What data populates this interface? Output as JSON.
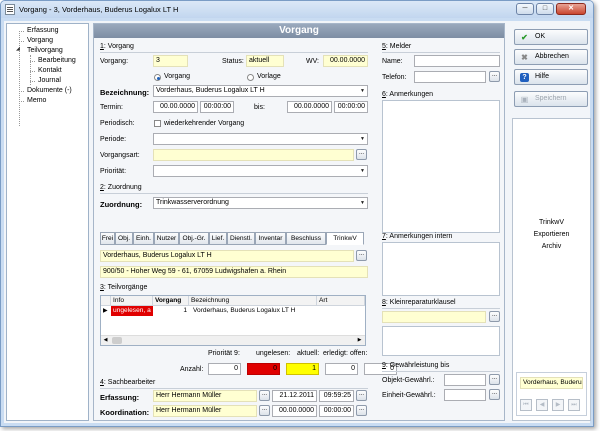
{
  "window": {
    "title": "Vorgang - 3, Vorderhaus, Buderus Logalux LT H",
    "min": "─",
    "max": "□",
    "close": "✕"
  },
  "tree": {
    "erfassung": "Erfassung",
    "vorgang": "Vorgang",
    "teilvorgang": "Teilvorgang",
    "bearbeitung": "Bearbeitung",
    "kontakt": "Kontakt",
    "journal": "Journal",
    "dokumente": "Dokumente (-)",
    "memo": "Memo"
  },
  "header": "Vorgang",
  "s1": {
    "title_num": "1",
    "title_text": ": Vorgang",
    "vorgang_label": "Vorgang:",
    "vorgang_value": "3",
    "status_label": "Status:",
    "status_value": "aktuell",
    "wv_label": "WV:",
    "wv_value": "00.00.0000",
    "radio_vorgang": "Vorgang",
    "radio_vorlage": "Vorlage",
    "bez_label": "Bezeichnung:",
    "bez_value": "Vorderhaus, Buderus Logalux LT H",
    "termin_label": "Termin:",
    "termin_date": "00.00.0000",
    "termin_time": "00:00:00",
    "bis_label": "bis:",
    "bis_date": "00.00.0000",
    "bis_time": "00:00:00",
    "periodisch_label": "Periodisch:",
    "periodisch_check": "wiederkehrender Vorgang",
    "periode_label": "Periode:",
    "vorgangsart_label": "Vorgangsart:",
    "prioritaet_label": "Priorität:",
    "dots": "..."
  },
  "s2": {
    "title_num": "2",
    "title_text": ": Zuordnung",
    "zuordnung_label": "Zuordnung:",
    "zuordnung_value": "Trinkwasserverordnung",
    "tabs": [
      "Frei",
      "Obj.",
      "Einh.",
      "Nutzer",
      "Obj.-Gr.",
      "Lief.",
      "Dienstl.",
      "Inventar",
      "Beschluss",
      "TrinkwV"
    ],
    "line1": "Vorderhaus, Buderus Logalux LT H",
    "line2": "900/50 - Hoher Weg 59 - 61, 67059 Ludwigshafen a. Rhein"
  },
  "s3": {
    "title_num": "3",
    "title_text": ": Teilvorgänge",
    "cols": [
      "Info",
      "Vorgang",
      "Bezeichnung",
      "Art"
    ],
    "row": {
      "marker": "▶",
      "info": "ungelesen, a",
      "vorgang": "1",
      "bez": "Vorderhaus, Buderus Logalux LT H",
      "art": ""
    },
    "prio_label": "Priorität 9:",
    "ungelesen_label": "ungelesen:",
    "aktuell_label": "aktuell:",
    "erledigt_label": "erledigt:",
    "offen_label": "offen:",
    "anzahl_label": "Anzahl:",
    "prio_val": "0",
    "ungelesen_val": "0",
    "aktuell_val": "1",
    "erledigt_val": "0",
    "offen_val": "0"
  },
  "s4": {
    "title_num": "4",
    "title_text": ": Sachbearbeiter",
    "erfassung_label": "Erfassung:",
    "erfassung_name": "Herr Hermann Müller",
    "erfassung_date": "21.12.2011",
    "erfassung_time": "09:59:25",
    "koord_label": "Koordination:",
    "koord_name": "Herr Hermann Müller",
    "koord_date": "00.00.0000",
    "koord_time": "00:00:00"
  },
  "s5": {
    "title_num": "5",
    "title_text": ": Melder",
    "name_label": "Name:",
    "telefon_label": "Telefon:"
  },
  "s6": {
    "title_num": "6",
    "title_text": ": Anmerkungen"
  },
  "s7": {
    "title_num": "7",
    "title_text": ": Anmerkungen intern"
  },
  "s8": {
    "title_num": "8",
    "title_text": ": Kleinreparaturklausel"
  },
  "s9": {
    "title_num": "9",
    "title_text": ": Gewährleistung bis",
    "objekt_label": "Objekt-Gewährl.:",
    "einheit_label": "Einheit-Gewährl.:"
  },
  "buttons": {
    "ok": "OK",
    "abbrechen": "Abbrechen",
    "hilfe": "Hilfe",
    "speichern": "Speichern"
  },
  "links": {
    "trinkwv": "TrinkwV",
    "exportieren": "Exportieren",
    "archiv": "Archiv"
  },
  "summary": {
    "text": "Vorderhaus, Buderus Logalux LT H"
  },
  "colors": {
    "red": "#e00000",
    "yellow": "#ffff00",
    "header": "#8493a8",
    "field_yellow": "#ffffd2"
  }
}
